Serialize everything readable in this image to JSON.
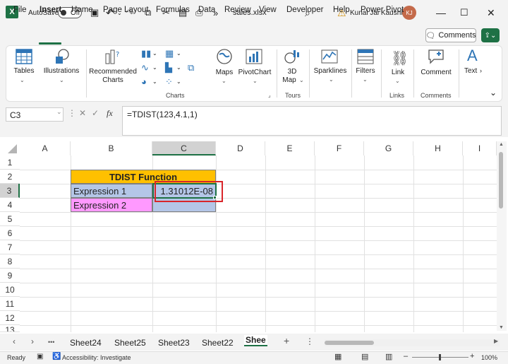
{
  "titlebar": {
    "app_letter": "X",
    "autosave_label": "AutoSave",
    "autosave_state": "Off",
    "filename": "sales.xlsx",
    "more": "»",
    "user_name": "Kunal Jai Kaushik",
    "user_initials": "KJ"
  },
  "menu": {
    "items": [
      "File",
      "Insert",
      "Home",
      "Page Layout",
      "Formulas",
      "Data",
      "Review",
      "View",
      "Developer",
      "Help",
      "Power Pivot"
    ],
    "active": "Insert",
    "comments_label": "Comments"
  },
  "ribbon": {
    "tables": "Tables",
    "illustrations": "Illustrations",
    "recommended_charts_1": "Recommended",
    "recommended_charts_2": "Charts",
    "maps": "Maps",
    "pivotchart": "PivotChart",
    "map3d_1": "3D",
    "map3d_2": "Map",
    "sparklines": "Sparklines",
    "filters": "Filters",
    "link": "Link",
    "comment": "Comment",
    "text": "Text",
    "group_charts": "Charts",
    "group_tours": "Tours",
    "group_links": "Links",
    "group_comments": "Comments"
  },
  "formula_bar": {
    "name_box": "C3",
    "fx": "fx",
    "formula": "=TDIST(123,4.1,1)"
  },
  "grid": {
    "columns": [
      "A",
      "B",
      "C",
      "D",
      "E",
      "F",
      "G",
      "H",
      "I"
    ],
    "rows": [
      "1",
      "2",
      "3",
      "4",
      "5",
      "6",
      "7",
      "8",
      "9",
      "10",
      "11",
      "12",
      "13"
    ],
    "selected_column": "C",
    "selected_row": "3",
    "title_cell": "TDIST Function",
    "b3": "Expression 1",
    "c3": "1.31012E-08",
    "b4": "Expression 2",
    "colors": {
      "title_bg": "#ffc000",
      "expr1_bg": "#b4c6e7",
      "expr2_bg": "#ff99ff",
      "highlight_border": "#d9252a"
    }
  },
  "sheets": {
    "tabs": [
      "Sheet24",
      "Sheet25",
      "Sheet23",
      "Sheet22",
      "Shee"
    ],
    "active": "Shee",
    "ellipsis": "•••",
    "add": "+",
    "more": "⋮"
  },
  "status": {
    "ready": "Ready",
    "accessibility": "Accessibility: Investigate",
    "zoom": "100%"
  }
}
